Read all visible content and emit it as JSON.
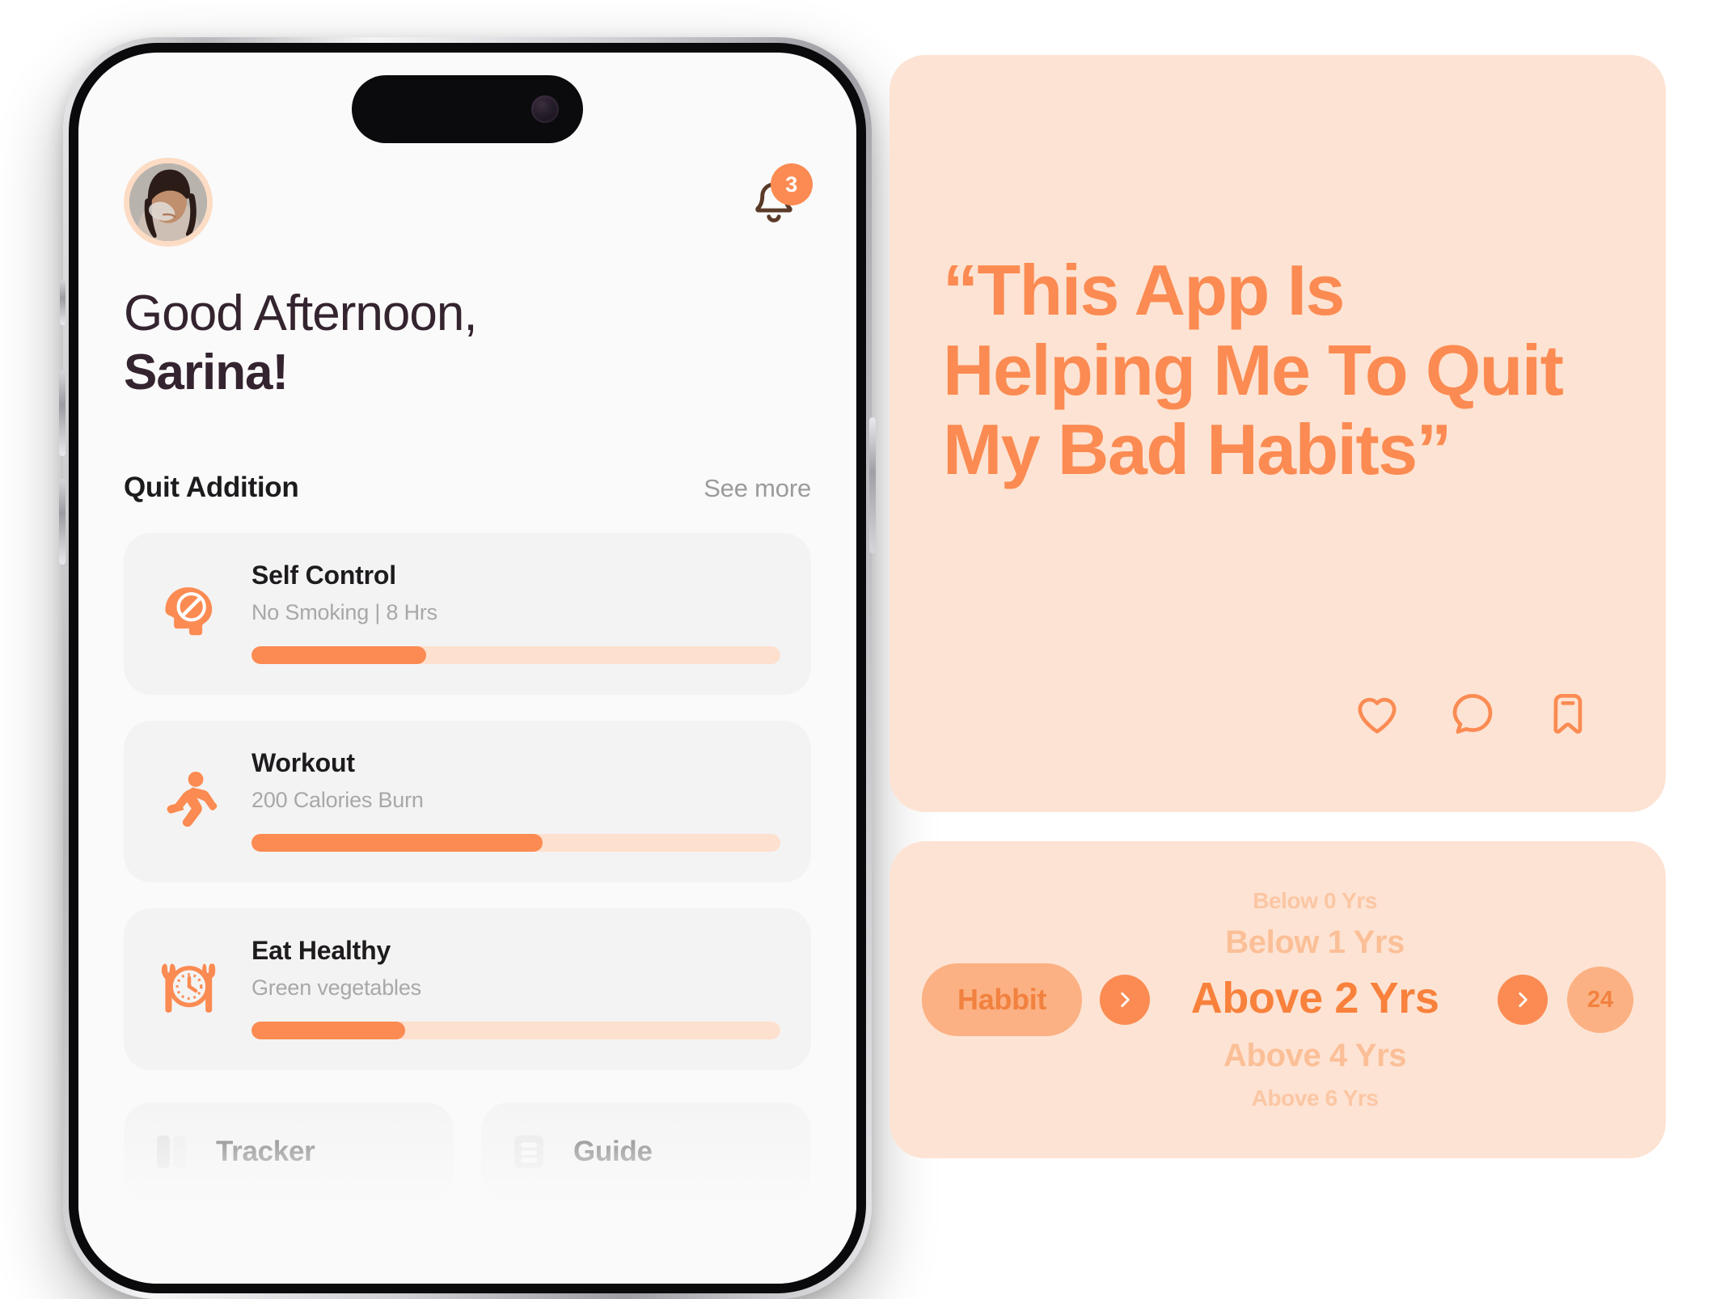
{
  "colors": {
    "accent": "#FB8B52",
    "accent_deep": "#F2813F",
    "peach_card": "#FDE3D3",
    "peach_pill": "#FBB183",
    "track": "#FDE0CE",
    "grey_card": "#F4F3F3",
    "text_dark": "#1D1B1E",
    "text_muted": "#A8A7A9",
    "screen_bg": "#FAFAFA"
  },
  "phone": {
    "avatar_alt": "user-avatar",
    "notifications": {
      "icon": "bell-icon",
      "badge_count": "3"
    },
    "greeting": {
      "line1": "Good Afternoon,",
      "line2": "Sarina!"
    },
    "section": {
      "title": "Quit Addition",
      "see_more": "See more"
    },
    "habits": [
      {
        "icon": "head-no-smoking-icon",
        "title": "Self Control",
        "subtitle": "No Smoking | 8 Hrs",
        "progress_pct": 33
      },
      {
        "icon": "running-person-icon",
        "title": "Workout",
        "subtitle": "200 Calories Burn",
        "progress_pct": 55
      },
      {
        "icon": "plate-clock-cutlery-icon",
        "title": "Eat Healthy",
        "subtitle": "Green vegetables",
        "progress_pct": 29
      }
    ],
    "quick_actions": [
      {
        "icon": "tracker-icon",
        "label": "Tracker"
      },
      {
        "icon": "guide-icon",
        "label": "Guide"
      }
    ]
  },
  "quote_card": {
    "text": "“This App Is Helping Me To Quit My Bad Habits”",
    "actions": [
      {
        "icon": "heart-icon",
        "name": "like"
      },
      {
        "icon": "comment-bubble-icon",
        "name": "comment"
      },
      {
        "icon": "bookmark-icon",
        "name": "save"
      }
    ]
  },
  "picker_card": {
    "category_pill": "Habbit",
    "prev_icon": "chevron-right-icon",
    "next_icon": "chevron-right-icon",
    "count_badge": "24",
    "options": [
      "Below 0 Yrs",
      "Below 1 Yrs",
      "Above 2 Yrs",
      "Above 4 Yrs",
      "Above 6 Yrs"
    ],
    "selected": "Above 2 Yrs",
    "selected_index": 2
  }
}
